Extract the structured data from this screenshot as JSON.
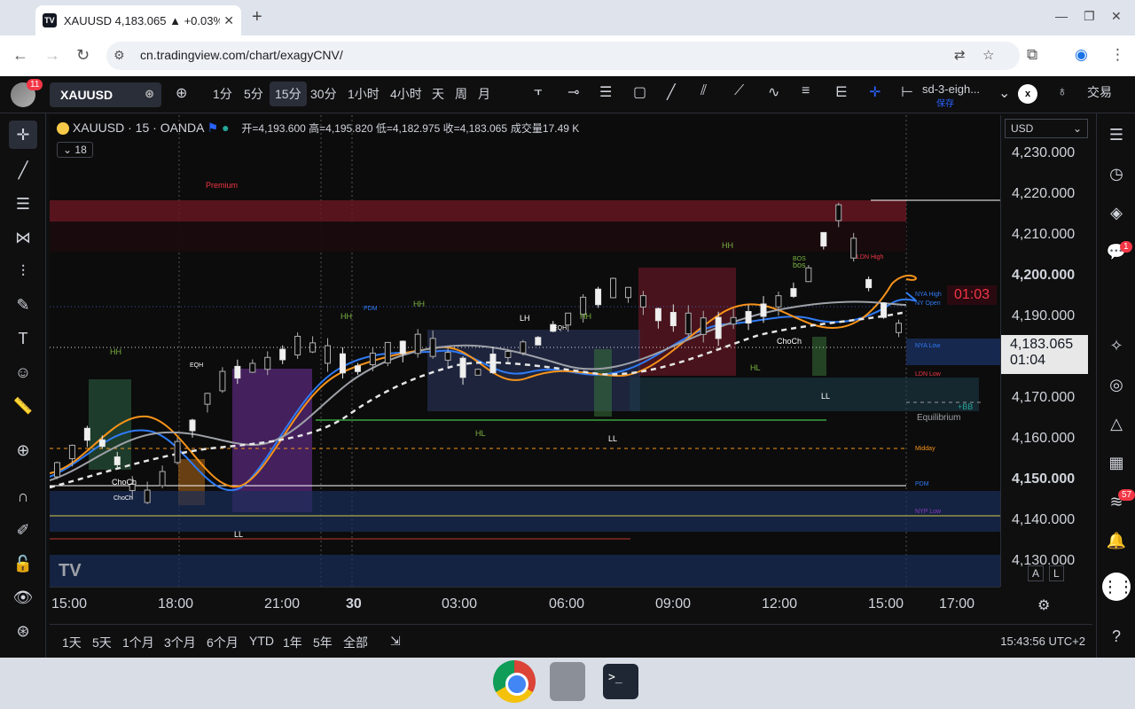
{
  "browser": {
    "tab_title": "XAUUSD 4,183.065 ▲ +0.03%",
    "tab_favicon": "TV",
    "url": "cn.tradingview.com/chart/exagyCNV/"
  },
  "topbar": {
    "avatar_badge": "11",
    "symbol": "XAUUSD",
    "timeframes": [
      "1分",
      "5分",
      "15分",
      "30分",
      "1小时",
      "4小时",
      "天",
      "周",
      "月"
    ],
    "active_timeframe": "15分",
    "script_name": "sd-3-eigh...",
    "script_sub": "保存",
    "close_label": "x",
    "trade_label": "交易"
  },
  "legend": {
    "title": "XAUUSD · 15 · OANDA",
    "ohlc": "开=4,193.600 高=4,195.820 低=4,182.975 收=4,183.065",
    "volume": "成交量17.49 K",
    "indicator_count": "18"
  },
  "price_axis": {
    "currency": "USD",
    "labels": [
      "4,230.000",
      "4,220.000",
      "4,210.000",
      "4,200.000",
      "4,190.000",
      "4,180.000",
      "4,170.000",
      "4,160.000",
      "4,150.000",
      "4,140.000",
      "4,130.000"
    ],
    "current_price": "4,183.065",
    "countdown": "01:04",
    "timer_red": "01:03",
    "axis_buttons": [
      "A",
      "L"
    ]
  },
  "time_axis": {
    "labels": [
      "15:00",
      "18:00",
      "21:00",
      "30",
      "03:00",
      "06:00",
      "09:00",
      "12:00",
      "15:00",
      "17:00"
    ]
  },
  "bottombar": {
    "ranges": [
      "1天",
      "5天",
      "1个月",
      "3个月",
      "6个月",
      "YTD",
      "1年",
      "5年",
      "全部"
    ],
    "clock": "15:43:56 UTC+2"
  },
  "right_panel": {
    "chat_badge": "1",
    "feed_badge": "57"
  },
  "chart_annotations": {
    "premium": "Premium",
    "equilibrium": "Equilibrium",
    "midday": "Midday",
    "labels": [
      "HH",
      "HH",
      "LH",
      "HH",
      "HH",
      "HH",
      "HL",
      "LL",
      "LL",
      "LL",
      "HL",
      "ChoCh",
      "ChoCh",
      "ChoCh",
      "BOS",
      "bos",
      "EQH",
      "EQH",
      "PDM",
      "PDM",
      "NYA High",
      "NY Open",
      "NYP Low",
      "LDN Low",
      "LDN High",
      "NYA Low",
      "+BB"
    ],
    "watermark": "TV"
  },
  "colors": {
    "bg": "#0c0c0c",
    "ema_blue": "#2f7bf5",
    "ema_orange": "#f7931a",
    "ema_grey": "#9ea1a8",
    "premium_zone": "#6b1622",
    "discount_zone": "#1a2e5a"
  }
}
